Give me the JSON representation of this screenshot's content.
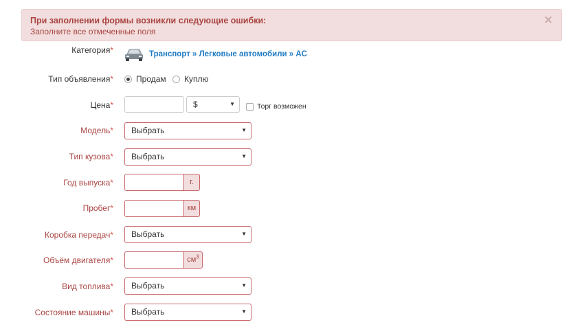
{
  "alert": {
    "title": "При заполнении формы возникли следующие ошибки:",
    "message": "Заполните все отмеченные поля",
    "close": "×"
  },
  "form": {
    "category": {
      "label": "Категория",
      "breadcrumb": "Транспорт » Легковые автомобили » AC"
    },
    "ad_type": {
      "label": "Тип объявления",
      "options": [
        "Продам",
        "Куплю"
      ],
      "selected": "Продам"
    },
    "price": {
      "label": "Цена",
      "value": "",
      "currency": "$",
      "negotiable_label": "Торг возможен",
      "negotiable": false
    },
    "model": {
      "label": "Модель",
      "value": "Выбрать"
    },
    "body_type": {
      "label": "Тип кузова",
      "value": "Выбрать"
    },
    "year": {
      "label": "Год выпуска",
      "value": "",
      "unit": "г."
    },
    "mileage": {
      "label": "Пробег",
      "value": "",
      "unit": "км"
    },
    "transmission": {
      "label": "Коробка передач",
      "value": "Выбрать"
    },
    "engine_volume": {
      "label": "Объём двигателя",
      "value": "",
      "unit": "см",
      "unit_sup": "3"
    },
    "fuel": {
      "label": "Вид топлива",
      "value": "Выбрать"
    },
    "condition": {
      "label": "Состояние машины",
      "value": "Выбрать"
    },
    "required_mark": "*"
  },
  "colors": {
    "error_text": "#a94442",
    "error_bg": "#f2dede",
    "error_border": "#c9686c",
    "link": "#1e7bc4"
  }
}
